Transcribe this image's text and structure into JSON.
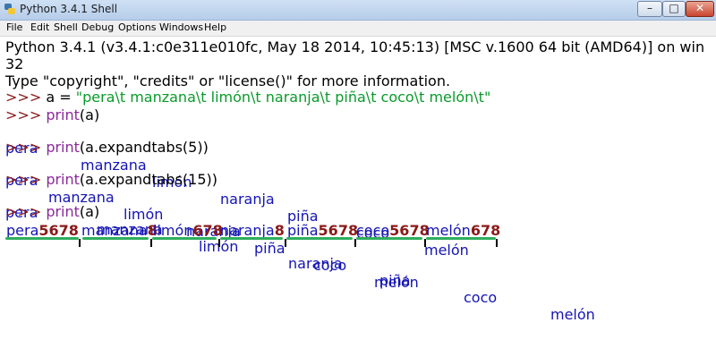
{
  "window": {
    "title": "Python 3.4.1 Shell",
    "minimize_glyph": "–",
    "maximize_glyph": "□",
    "close_glyph": "✕"
  },
  "menu": [
    "File",
    "Edit",
    "Shell",
    "Debug",
    "Options",
    "Windows",
    "Help"
  ],
  "shell": {
    "banner1": "Python 3.4.1 (v3.4.1:c0e311e010fc, May 18 2014, 10:45:13) [MSC v.1600 64 bit (AMD64)] on win",
    "banner2": "32",
    "banner3": "Type \"copyright\", \"credits\" or \"license()\" for more information.",
    "prompt": ">>> ",
    "cmd1_code": "a = ",
    "cmd1_string": "\"pera\\t manzana\\t limón\\t naranja\\t piña\\t coco\\t melón\\t\"",
    "cmd2_print": "print",
    "cmd2_arg": "(a)",
    "out1": [
      "pera",
      "manzana",
      "limón",
      "naranja",
      "piña",
      "coco",
      "melón"
    ],
    "cmd3_print": "print",
    "cmd3_arg": "(a.expandtabs(5))",
    "out2": [
      "pera",
      "manzana",
      "limón",
      "naranja",
      "piña",
      "coco",
      "melón"
    ],
    "cmd4_print": "print",
    "cmd4_arg": "(a.expandtabs(15))",
    "out3": [
      "pera",
      "manzana",
      "limón",
      "naranja",
      "piña",
      "coco",
      "melón"
    ],
    "cmd5_print": "print",
    "cmd5_arg": "(a)",
    "annotated": [
      {
        "word": "pera",
        "pad": "5678"
      },
      {
        "word": "manzana",
        "pad": "8"
      },
      {
        "word": "limón",
        "pad": "678"
      },
      {
        "word": "naranja",
        "pad": "8"
      },
      {
        "word": "piña",
        "pad": "5678"
      },
      {
        "word": "coco",
        "pad": "5678"
      },
      {
        "word": "melón",
        "pad": "678"
      }
    ]
  },
  "colors": {
    "prompt": "#8b1a1a",
    "output": "#1414b4",
    "string": "#0a9a2a",
    "builtin": "#8b2a9a",
    "annotation_underline": "#2fae5d",
    "annotation_number": "#8b1a1a"
  }
}
